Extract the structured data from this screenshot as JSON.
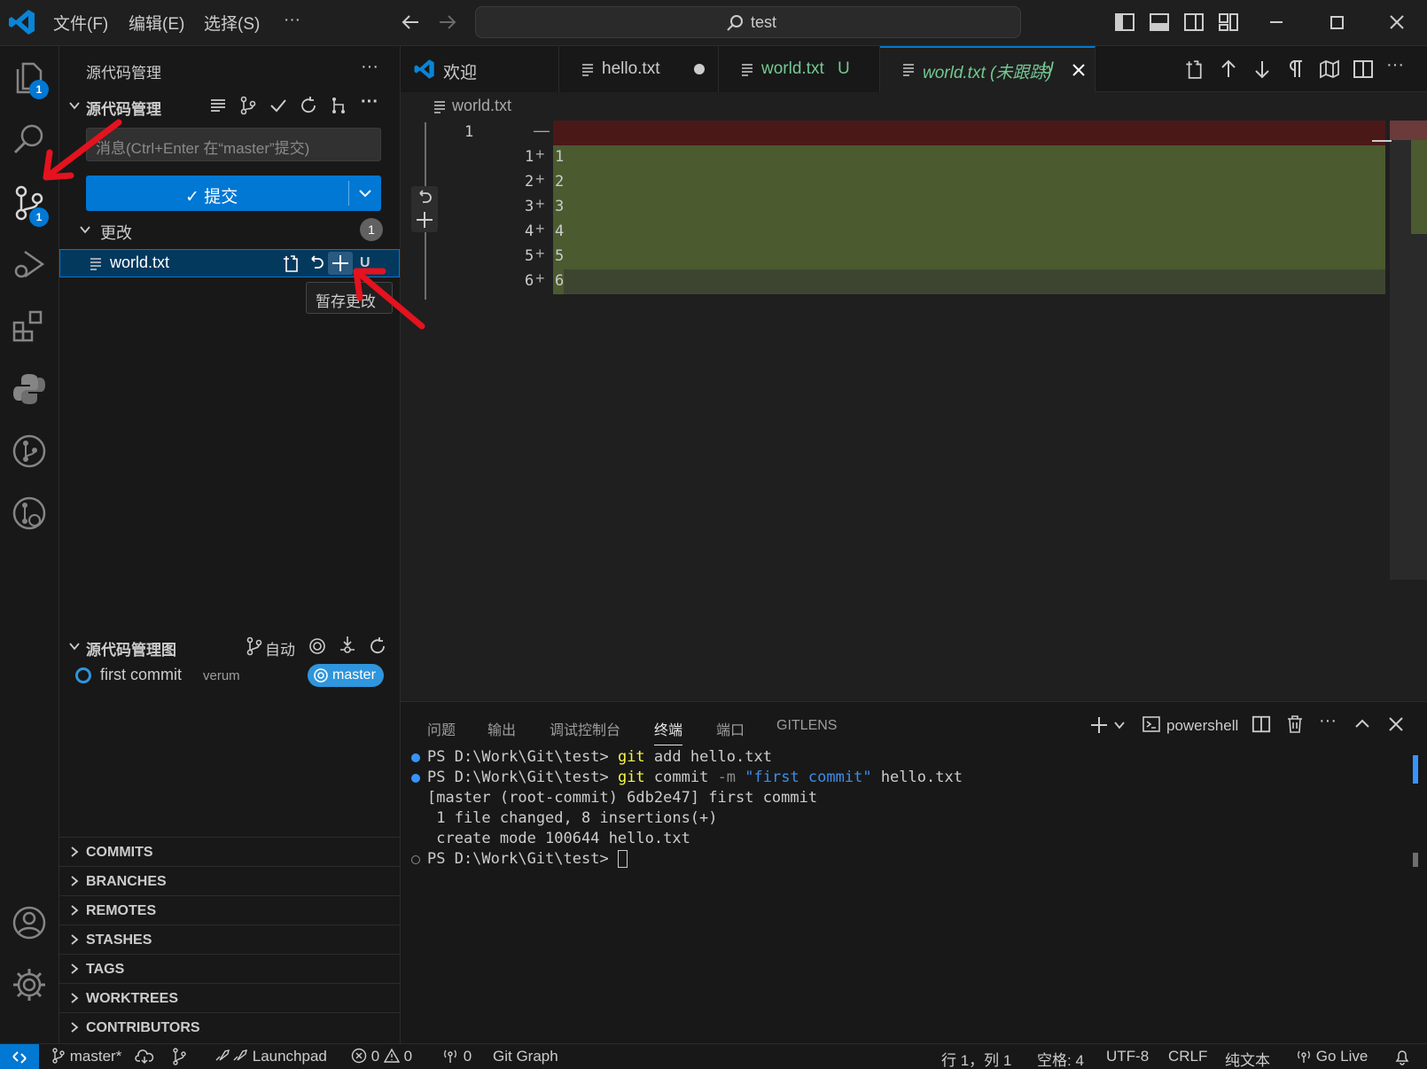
{
  "titlebar": {
    "menus": [
      "文件(F)",
      "编辑(E)",
      "选择(S)",
      "···"
    ],
    "search": "test"
  },
  "activity": {
    "explorer_badge": "1",
    "scm_badge": "1"
  },
  "sidebar": {
    "title": "源代码管理",
    "scm_section": "源代码管理",
    "commit_placeholder": "消息(Ctrl+Enter 在“master”提交)",
    "commit_label": "✓ 提交",
    "changes_label": "更改",
    "changes_count": "1",
    "file_name": "world.txt",
    "file_status": "U",
    "tooltip": "暂存更改",
    "graph_section": "源代码管理图",
    "graph_auto": "自动",
    "commit_message": "first commit",
    "commit_author": "verum",
    "branch_badge": "master",
    "bottom_sections": [
      "COMMITS",
      "BRANCHES",
      "REMOTES",
      "STASHES",
      "TAGS",
      "WORKTREES",
      "CONTRIBUTORS"
    ]
  },
  "tabs": [
    {
      "label": "欢迎"
    },
    {
      "label": "hello.txt"
    },
    {
      "label": "world.txt",
      "status": "U"
    },
    {
      "label": "world.txt (未跟踪)",
      "status": "U"
    }
  ],
  "breadcrumb": "world.txt",
  "editor": {
    "old_line": "1",
    "removed_marker": "—",
    "lines": [
      {
        "num": "1",
        "text": "1"
      },
      {
        "num": "2",
        "text": "2"
      },
      {
        "num": "3",
        "text": "3"
      },
      {
        "num": "4",
        "text": "4"
      },
      {
        "num": "5",
        "text": "5"
      },
      {
        "num": "6",
        "text": "6"
      }
    ]
  },
  "panel": {
    "tabs": [
      "问题",
      "输出",
      "调试控制台",
      "终端",
      "端口",
      "GITLENS"
    ],
    "shell": "powershell",
    "terminal": {
      "prompt": "PS D:\\Work\\Git\\test>",
      "cmd1_git": "git",
      "cmd1_rest": " add hello.txt",
      "cmd2_git": "git",
      "cmd2_mid": " commit ",
      "cmd2_flag": "-m",
      "cmd2_str": " \"first commit\"",
      "cmd2_rest": " hello.txt",
      "out1": "[master (root-commit) 6db2e47] first commit",
      "out2": " 1 file changed, 8 insertions(+)",
      "out3": " create mode 100644 hello.txt"
    }
  },
  "statusbar": {
    "branch": "master*",
    "launchpad": "Launchpad",
    "errors": "0",
    "warnings": "0",
    "ports": "0",
    "git_graph": "Git Graph",
    "position": "行 1，列 1",
    "spaces": "空格: 4",
    "encoding": "UTF-8",
    "eol": "CRLF",
    "language": "纯文本",
    "golive": "Go Live"
  },
  "colors": {
    "accent": "#0078d4",
    "added_bg": "#4b5a2f",
    "removed_bg": "#4b1818",
    "untracked_green": "#73c991"
  }
}
